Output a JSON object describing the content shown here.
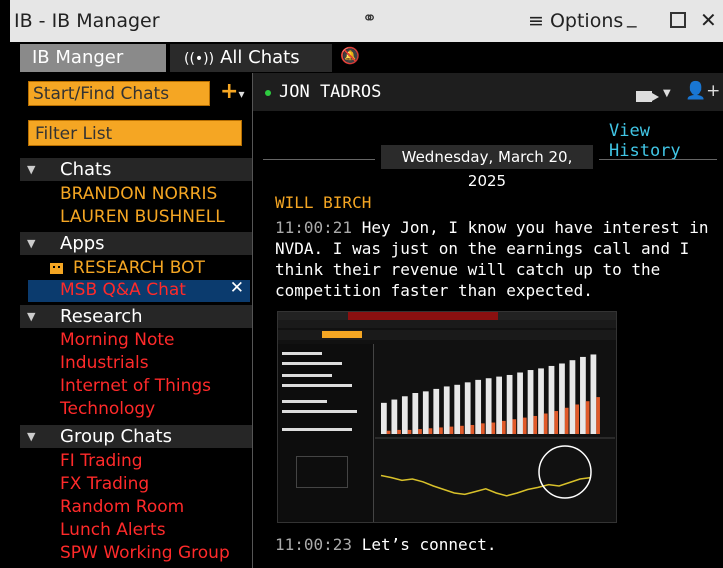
{
  "window": {
    "title": "IB - IB Manager",
    "link_icon": "link-icon",
    "options_label": "≡ Options",
    "min_label": "_",
    "close_label": "✕"
  },
  "tabs": [
    {
      "label": "IB Manger",
      "active": true
    },
    {
      "label": "All Chats",
      "icon": "broadcast-icon"
    },
    {
      "label": "",
      "icon": "mute-bell-icon"
    }
  ],
  "sidebar": {
    "search_label": "Start/Find Chats",
    "plus_label": "+",
    "filter_label": "Filter List",
    "sections": [
      {
        "label": "Chats",
        "items": [
          "BRANDON NORRIS",
          "LAUREN BUSHNELL"
        ]
      },
      {
        "label": "Apps",
        "items": [
          "RESEARCH BOT",
          "MSB Q&A Chat"
        ]
      },
      {
        "label": "Research",
        "items": [
          "Morning Note",
          "Industrials",
          "Internet of Things",
          "Technology"
        ]
      },
      {
        "label": "Group Chats",
        "items": [
          "FI Trading",
          "FX Trading",
          "Random Room",
          "Lunch Alerts",
          "SPW Working Group"
        ]
      }
    ],
    "selected_item_close": "✕"
  },
  "chat": {
    "contact": "JON TADROS",
    "status_color": "#2ecc40",
    "view_history": "View History",
    "date": "Wednesday, March 20, 2025",
    "sender": "WILL BIRCH",
    "messages": [
      {
        "time": "11:00:21",
        "text": "Hey Jon, I know you have interest in NVDA. I was just on the earnings call and I think their revenue will catch up to the competition faster than expected."
      },
      {
        "time": "11:00:23",
        "text": "Let’s connect."
      }
    ],
    "attachment": {
      "bars": [
        38,
        42,
        46,
        50,
        52,
        55,
        58,
        60,
        63,
        66,
        68,
        70,
        72,
        75,
        78,
        80,
        83,
        86,
        90,
        94,
        97
      ],
      "orange_bars": [
        4,
        5,
        5,
        6,
        7,
        8,
        9,
        10,
        11,
        13,
        14,
        16,
        18,
        20,
        22,
        25,
        28,
        32,
        36,
        40,
        45
      ],
      "line": [
        55,
        52,
        48,
        50,
        46,
        40,
        35,
        30,
        28,
        32,
        36,
        30,
        26,
        30,
        35,
        38,
        42,
        40,
        45,
        50,
        52
      ]
    }
  },
  "colors": {
    "accent": "#f5a623",
    "red_items": "#ff2a2a",
    "link": "#41c6e6"
  }
}
